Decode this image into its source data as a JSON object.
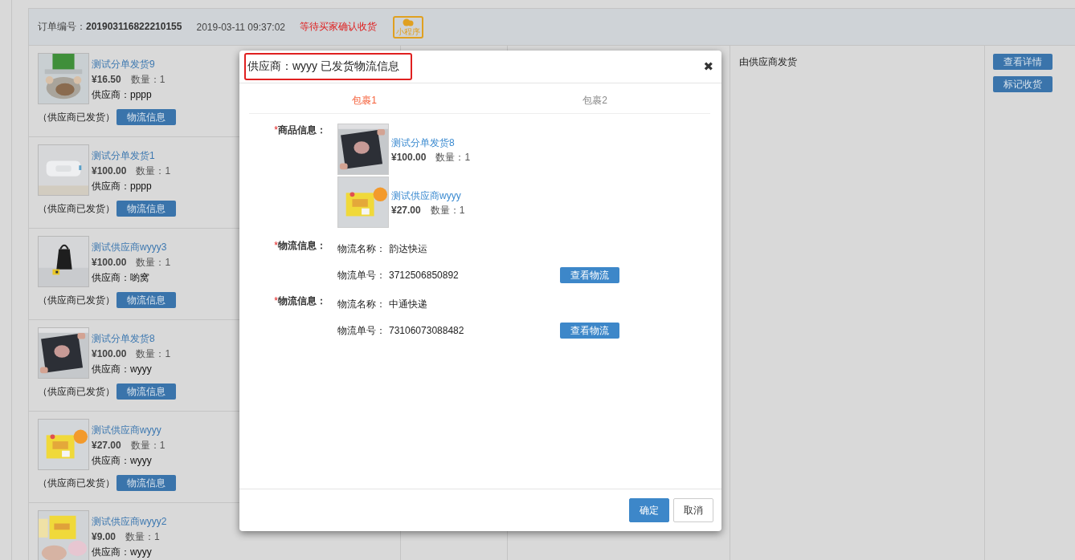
{
  "order": {
    "number_label": "订单编号：",
    "number": "201903116822210155",
    "time": "2019-03-11 09:37:02",
    "status": "等待买家确认收货",
    "badge_label": "小程序"
  },
  "items": [
    {
      "title": "测试分单发货9",
      "price": "¥16.50",
      "quantity": "数量：1",
      "supplier": "供应商：pppp",
      "note": "（供应商已发货）",
      "button": "物流信息"
    },
    {
      "title": "测试分单发货1",
      "price": "¥100.00",
      "quantity": "数量：1",
      "supplier": "供应商：pppp",
      "note": "（供应商已发货）",
      "button": "物流信息"
    },
    {
      "title": "测试供应商wyyy3",
      "price": "¥100.00",
      "quantity": "数量：1",
      "supplier": "供应商：喲窝",
      "note": "（供应商已发货）",
      "button": "物流信息"
    },
    {
      "title": "测试分单发货8",
      "price": "¥100.00",
      "quantity": "数量：1",
      "supplier": "供应商：wyyy",
      "note": "（供应商已发货）",
      "button": "物流信息"
    },
    {
      "title": "测试供应商wyyy",
      "price": "¥27.00",
      "quantity": "数量：1",
      "supplier": "供应商：wyyy",
      "note": "（供应商已发货）",
      "button": "物流信息"
    },
    {
      "title": "测试供应商wyyy2",
      "price": "¥9.00",
      "quantity": "数量：1",
      "supplier": "供应商：wyyy"
    }
  ],
  "shipping_note": "由供应商发货",
  "actions": [
    "查看详情",
    "标记收货"
  ],
  "modal": {
    "title": "供应商：wyyy 已发货物流信息",
    "close": "✖",
    "tabs": [
      {
        "label": "包裹1",
        "selected": true
      },
      {
        "label": "包裹2",
        "selected": false
      }
    ],
    "goods_label": {
      "mark": "*",
      "text": "商品信息："
    },
    "goods": [
      {
        "title": "测试分单发货8",
        "price": "¥100.00",
        "quantity": "数量：1"
      },
      {
        "title": "测试供应商wyyy",
        "price": "¥27.00",
        "quantity": "数量：1"
      }
    ],
    "shipments": [
      {
        "mark": "*",
        "label": "物流信息：",
        "name_label": "物流名称：",
        "name": "韵达快运",
        "number_label": "物流单号：",
        "number": "3712506850892",
        "button": "查看物流"
      },
      {
        "mark": "*",
        "label": "物流信息：",
        "name_label": "物流名称：",
        "name": "中通快递",
        "number_label": "物流单号：",
        "number": "73106073088482",
        "button": "查看物流"
      }
    ],
    "buttons": [
      {
        "label": "确定",
        "kind": "primary"
      },
      {
        "label": "取消",
        "kind": "default"
      }
    ]
  }
}
